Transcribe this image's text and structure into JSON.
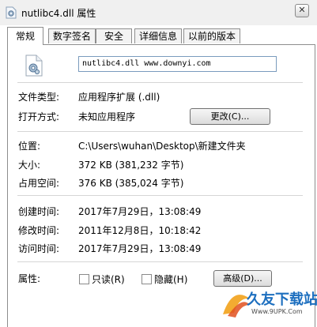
{
  "window": {
    "title": "nutlibc4.dll 属性",
    "close_glyph": "✕"
  },
  "tabs": [
    {
      "label": "常规",
      "active": true
    },
    {
      "label": "数字签名",
      "active": false
    },
    {
      "label": "安全",
      "active": false
    },
    {
      "label": "详细信息",
      "active": false
    },
    {
      "label": "以前的版本",
      "active": false
    }
  ],
  "general": {
    "file_name": "nutlibc4.dll www.downyi.com",
    "type_label": "文件类型:",
    "type_value": "应用程序扩展 (.dll)",
    "opens_with_label": "打开方式:",
    "opens_with_value": "未知应用程序",
    "change_button": "更改(C)...",
    "location_label": "位置:",
    "location_value": "C:\\Users\\wuhan\\Desktop\\新建文件夹",
    "size_label": "大小:",
    "size_value": "372 KB (381,232 字节)",
    "size_on_disk_label": "占用空间:",
    "size_on_disk_value": "376 KB (385,024 字节)",
    "created_label": "创建时间:",
    "created_value": "2017年7月29日，13:08:49",
    "modified_label": "修改时间:",
    "modified_value": "2011年12月8日，10:18:42",
    "accessed_label": "访问时间:",
    "accessed_value": "2017年7月29日，13:08:49",
    "attributes_label": "属性:",
    "readonly_label": "只读(R)",
    "hidden_label": "隐藏(H)",
    "advanced_button": "高级(D)..."
  },
  "watermark": {
    "text": "久友下载站",
    "url": "Www.9UPK.Com"
  },
  "colors": {
    "accent": "#1d6fbf",
    "border": "#8d8d8d"
  }
}
